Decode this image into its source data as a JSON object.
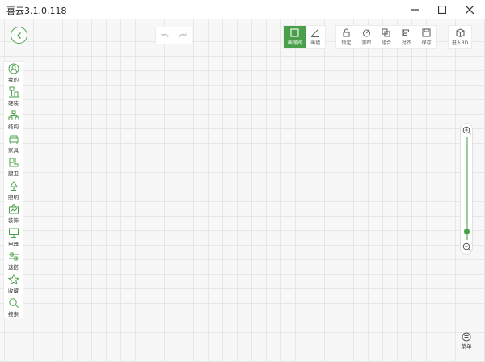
{
  "window": {
    "title": "喜云3.1.0.118"
  },
  "toolbar": {
    "draw_tools": [
      {
        "id": "room",
        "label": "画房间",
        "icon": "square-icon",
        "active": true
      },
      {
        "id": "wall",
        "label": "画墙",
        "icon": "pen-icon",
        "active": false
      }
    ],
    "edit_tools": [
      {
        "id": "lock",
        "label": "锁定",
        "icon": "lock-icon"
      },
      {
        "id": "measure",
        "label": "测距",
        "icon": "measure-icon"
      },
      {
        "id": "group",
        "label": "组合",
        "icon": "group-icon"
      },
      {
        "id": "align",
        "label": "对齐",
        "icon": "align-icon"
      },
      {
        "id": "save",
        "label": "保存",
        "icon": "save-icon"
      }
    ],
    "enter_3d_label": "进入3D"
  },
  "sidebar": {
    "items": [
      {
        "label": "我的",
        "icon": "user-icon"
      },
      {
        "label": "硬装",
        "icon": "hardware-icon"
      },
      {
        "label": "结构",
        "icon": "structure-icon"
      },
      {
        "label": "家具",
        "icon": "sofa-icon"
      },
      {
        "label": "厨卫",
        "icon": "kitchen-icon"
      },
      {
        "label": "照明",
        "icon": "lamp-icon"
      },
      {
        "label": "装饰",
        "icon": "picture-icon"
      },
      {
        "label": "电器",
        "icon": "monitor-icon"
      },
      {
        "label": "速搭",
        "icon": "quick-build-icon"
      },
      {
        "label": "收藏",
        "icon": "star-icon"
      },
      {
        "label": "搜索",
        "icon": "search-icon"
      }
    ]
  },
  "zoom": {
    "level_fraction": 0.08
  },
  "menu": {
    "label": "菜单"
  },
  "colors": {
    "accent": "#4aa04a",
    "canvas_bg": "#f7f7f7",
    "grid_line": "#e6e6e6"
  }
}
